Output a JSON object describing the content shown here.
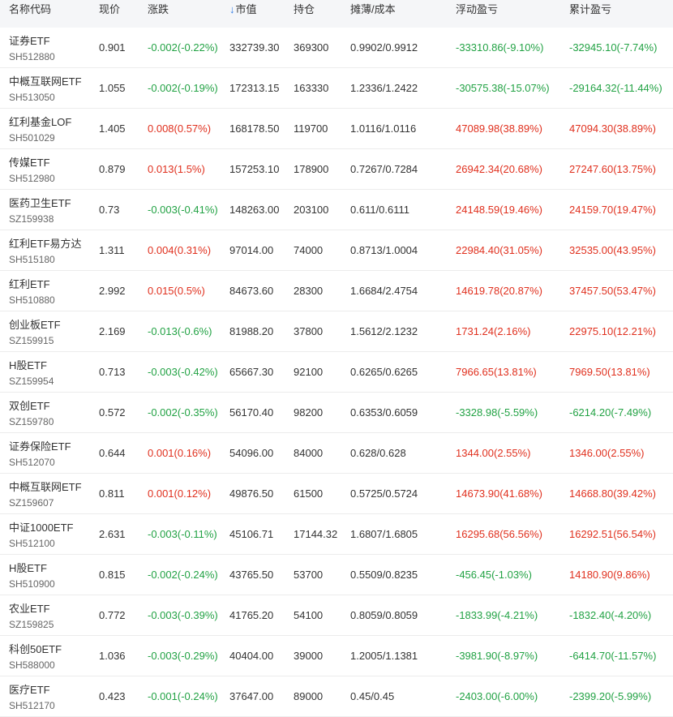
{
  "header": {
    "name": "名称代码",
    "price": "现价",
    "change": "涨跌",
    "sort_icon": "↓",
    "market_value": "市值",
    "holdings": "持仓",
    "cost": "摊薄/成本",
    "float_pnl": "浮动盈亏",
    "total_pnl": "累计盈亏"
  },
  "colors": {
    "up": "#e0301e",
    "down": "#22a244",
    "sort": "#2f7be5"
  },
  "rows": [
    {
      "name": "证券ETF",
      "code": "SH512880",
      "price": "0.901",
      "change": "-0.002(-0.22%)",
      "mv": "332739.30",
      "qty": "369300",
      "cost": "0.9902/0.9912",
      "float_pnl": "-33310.86(-9.10%)",
      "total_pnl": "-32945.10(-7.74%)"
    },
    {
      "name": "中概互联网ETF",
      "code": "SH513050",
      "price": "1.055",
      "change": "-0.002(-0.19%)",
      "mv": "172313.15",
      "qty": "163330",
      "cost": "1.2336/1.2422",
      "float_pnl": "-30575.38(-15.07%)",
      "total_pnl": "-29164.32(-11.44%)"
    },
    {
      "name": "红利基金LOF",
      "code": "SH501029",
      "price": "1.405",
      "change": "0.008(0.57%)",
      "mv": "168178.50",
      "qty": "119700",
      "cost": "1.0116/1.0116",
      "float_pnl": "47089.98(38.89%)",
      "total_pnl": "47094.30(38.89%)"
    },
    {
      "name": "传媒ETF",
      "code": "SH512980",
      "price": "0.879",
      "change": "0.013(1.5%)",
      "mv": "157253.10",
      "qty": "178900",
      "cost": "0.7267/0.7284",
      "float_pnl": "26942.34(20.68%)",
      "total_pnl": "27247.60(13.75%)"
    },
    {
      "name": "医药卫生ETF",
      "code": "SZ159938",
      "price": "0.73",
      "change": "-0.003(-0.41%)",
      "mv": "148263.00",
      "qty": "203100",
      "cost": "0.611/0.6111",
      "float_pnl": "24148.59(19.46%)",
      "total_pnl": "24159.70(19.47%)"
    },
    {
      "name": "红利ETF易方达",
      "code": "SH515180",
      "price": "1.311",
      "change": "0.004(0.31%)",
      "mv": "97014.00",
      "qty": "74000",
      "cost": "0.8713/1.0004",
      "float_pnl": "22984.40(31.05%)",
      "total_pnl": "32535.00(43.95%)"
    },
    {
      "name": "红利ETF",
      "code": "SH510880",
      "price": "2.992",
      "change": "0.015(0.5%)",
      "mv": "84673.60",
      "qty": "28300",
      "cost": "1.6684/2.4754",
      "float_pnl": "14619.78(20.87%)",
      "total_pnl": "37457.50(53.47%)"
    },
    {
      "name": "创业板ETF",
      "code": "SZ159915",
      "price": "2.169",
      "change": "-0.013(-0.6%)",
      "mv": "81988.20",
      "qty": "37800",
      "cost": "1.5612/2.1232",
      "float_pnl": "1731.24(2.16%)",
      "total_pnl": "22975.10(12.21%)"
    },
    {
      "name": "H股ETF",
      "code": "SZ159954",
      "price": "0.713",
      "change": "-0.003(-0.42%)",
      "mv": "65667.30",
      "qty": "92100",
      "cost": "0.6265/0.6265",
      "float_pnl": "7966.65(13.81%)",
      "total_pnl": "7969.50(13.81%)"
    },
    {
      "name": "双创ETF",
      "code": "SZ159780",
      "price": "0.572",
      "change": "-0.002(-0.35%)",
      "mv": "56170.40",
      "qty": "98200",
      "cost": "0.6353/0.6059",
      "float_pnl": "-3328.98(-5.59%)",
      "total_pnl": "-6214.20(-7.49%)"
    },
    {
      "name": "证券保险ETF",
      "code": "SH512070",
      "price": "0.644",
      "change": "0.001(0.16%)",
      "mv": "54096.00",
      "qty": "84000",
      "cost": "0.628/0.628",
      "float_pnl": "1344.00(2.55%)",
      "total_pnl": "1346.00(2.55%)"
    },
    {
      "name": "中概互联网ETF",
      "code": "SZ159607",
      "price": "0.811",
      "change": "0.001(0.12%)",
      "mv": "49876.50",
      "qty": "61500",
      "cost": "0.5725/0.5724",
      "float_pnl": "14673.90(41.68%)",
      "total_pnl": "14668.80(39.42%)"
    },
    {
      "name": "中证1000ETF",
      "code": "SH512100",
      "price": "2.631",
      "change": "-0.003(-0.11%)",
      "mv": "45106.71",
      "qty": "17144.32",
      "cost": "1.6807/1.6805",
      "float_pnl": "16295.68(56.56%)",
      "total_pnl": "16292.51(56.54%)"
    },
    {
      "name": "H股ETF",
      "code": "SH510900",
      "price": "0.815",
      "change": "-0.002(-0.24%)",
      "mv": "43765.50",
      "qty": "53700",
      "cost": "0.5509/0.8235",
      "float_pnl": "-456.45(-1.03%)",
      "total_pnl": "14180.90(9.86%)"
    },
    {
      "name": "农业ETF",
      "code": "SZ159825",
      "price": "0.772",
      "change": "-0.003(-0.39%)",
      "mv": "41765.20",
      "qty": "54100",
      "cost": "0.8059/0.8059",
      "float_pnl": "-1833.99(-4.21%)",
      "total_pnl": "-1832.40(-4.20%)"
    },
    {
      "name": "科创50ETF",
      "code": "SH588000",
      "price": "1.036",
      "change": "-0.003(-0.29%)",
      "mv": "40404.00",
      "qty": "39000",
      "cost": "1.2005/1.1381",
      "float_pnl": "-3981.90(-8.97%)",
      "total_pnl": "-6414.70(-11.57%)"
    },
    {
      "name": "医疗ETF",
      "code": "SH512170",
      "price": "0.423",
      "change": "-0.001(-0.24%)",
      "mv": "37647.00",
      "qty": "89000",
      "cost": "0.45/0.45",
      "float_pnl": "-2403.00(-6.00%)",
      "total_pnl": "-2399.20(-5.99%)"
    }
  ]
}
